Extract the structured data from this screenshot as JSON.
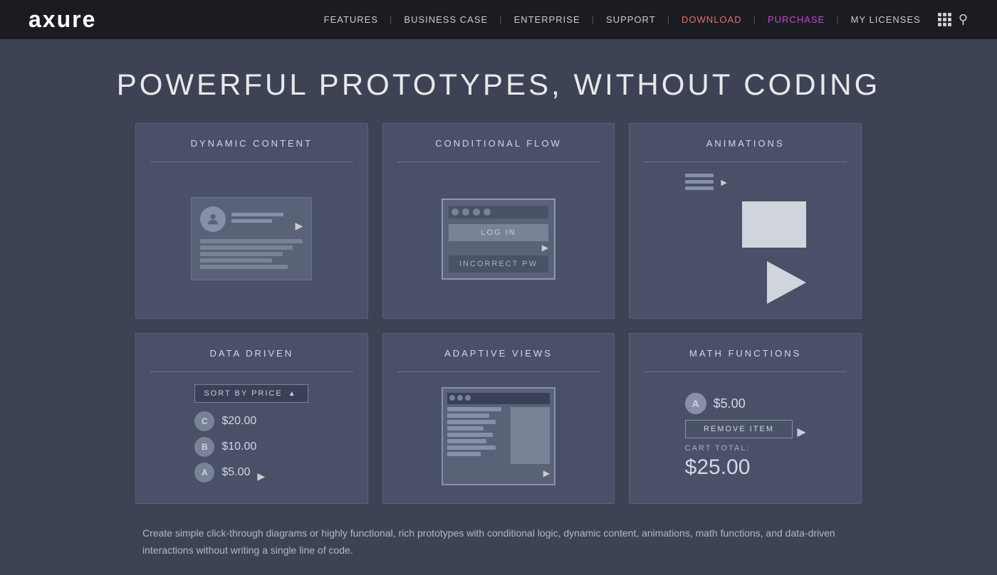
{
  "header": {
    "logo": "axure",
    "nav": [
      {
        "label": "FEATURES",
        "class": "normal"
      },
      {
        "label": "BUSINESS CASE",
        "class": "normal"
      },
      {
        "label": "ENTERPRISE",
        "class": "normal"
      },
      {
        "label": "SUPPORT",
        "class": "normal"
      },
      {
        "label": "DOWNLOAD",
        "class": "download"
      },
      {
        "label": "PURCHASE",
        "class": "purchase"
      },
      {
        "label": "MY LICENSES",
        "class": "normal"
      }
    ]
  },
  "hero": {
    "title": "POWERFUL PROTOTYPES, WITHOUT CODING"
  },
  "features": [
    {
      "id": "dynamic-content",
      "title": "DYNAMIC CONTENT"
    },
    {
      "id": "conditional-flow",
      "title": "CONDITIONAL FLOW"
    },
    {
      "id": "animations",
      "title": "ANIMATIONS"
    },
    {
      "id": "data-driven",
      "title": "DATA DRIVEN"
    },
    {
      "id": "adaptive-views",
      "title": "ADAPTIVE VIEWS"
    },
    {
      "id": "math-functions",
      "title": "MATH FUNCTIONS"
    }
  ],
  "data_driven": {
    "sort_label": "SORT BY PRICE",
    "items": [
      {
        "badge": "C",
        "price": "$20.00"
      },
      {
        "badge": "B",
        "price": "$10.00"
      },
      {
        "badge": "A",
        "price": "$5.00"
      }
    ]
  },
  "conditional_flow": {
    "login_label": "LOG IN",
    "error_label": "INCORRECT PW"
  },
  "math_functions": {
    "item_badge": "A",
    "item_price": "$5.00",
    "remove_btn": "REMOVE ITEM",
    "cart_total_label": "CART TOTAL:",
    "cart_total_value": "$25.00"
  },
  "footer": {
    "text": "Create simple click-through diagrams or highly functional, rich prototypes with conditional logic, dynamic content, animations, math functions, and data-driven interactions without writing a single line of code."
  }
}
